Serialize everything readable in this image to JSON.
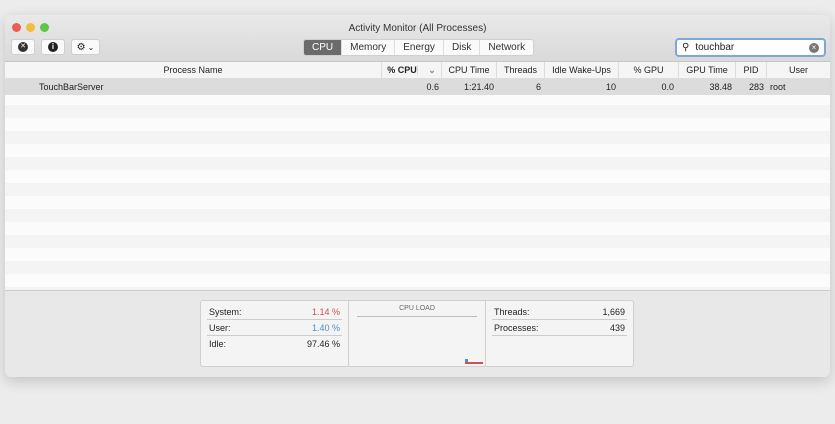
{
  "window": {
    "title": "Activity Monitor (All Processes)"
  },
  "toolbar": {
    "stop_icon": "✕",
    "info_icon": "i",
    "gear_icon": "⚙",
    "chevron": "⌄"
  },
  "tabs": [
    {
      "label": "CPU"
    },
    {
      "label": "Memory"
    },
    {
      "label": "Energy"
    },
    {
      "label": "Disk"
    },
    {
      "label": "Network"
    }
  ],
  "search": {
    "value": "touchbar",
    "icon": "search-icon",
    "clear": "×"
  },
  "columns": [
    "Process Name",
    "% CPU",
    "CPU Time",
    "Threads",
    "Idle Wake-Ups",
    "% GPU",
    "GPU Time",
    "PID",
    "User"
  ],
  "sort_indicator": "⌄",
  "rows": [
    {
      "name": "TouchBarServer",
      "cpu": "0.6",
      "cpu_time": "1:21.40",
      "threads": "6",
      "idle_wakeups": "10",
      "gpu": "0.0",
      "gpu_time": "38.48",
      "pid": "283",
      "user": "root"
    }
  ],
  "stats": {
    "system_label": "System:",
    "system": "1.14 %",
    "user_label": "User:",
    "user": "1.40 %",
    "idle_label": "Idle:",
    "idle": "97.46 %",
    "cpu_load_title": "CPU LOAD",
    "threads_label": "Threads:",
    "threads": "1,669",
    "processes_label": "Processes:",
    "processes": "439"
  },
  "colors": {
    "system": "#d05050",
    "user": "#4a90c8"
  }
}
